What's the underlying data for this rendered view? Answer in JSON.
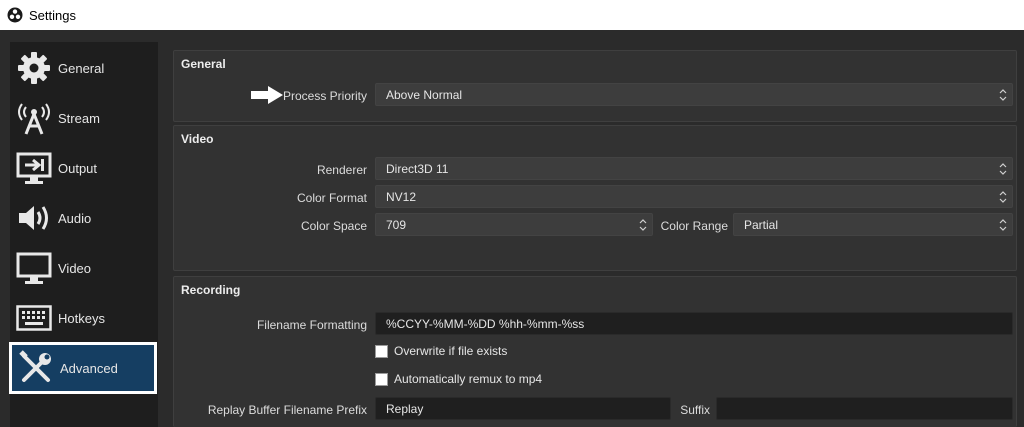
{
  "window": {
    "title": "Settings"
  },
  "sidebar": {
    "items": [
      {
        "label": "General",
        "icon": "gear-icon"
      },
      {
        "label": "Stream",
        "icon": "broadcast-antenna-icon"
      },
      {
        "label": "Output",
        "icon": "output-monitor-icon"
      },
      {
        "label": "Audio",
        "icon": "speaker-icon"
      },
      {
        "label": "Video",
        "icon": "monitor-icon"
      },
      {
        "label": "Hotkeys",
        "icon": "keyboard-icon"
      },
      {
        "label": "Advanced",
        "icon": "tools-icon",
        "selected": true
      }
    ]
  },
  "general": {
    "title": "General",
    "process_priority_label": "Process Priority",
    "process_priority_value": "Above Normal"
  },
  "video": {
    "title": "Video",
    "renderer_label": "Renderer",
    "renderer_value": "Direct3D 11",
    "color_format_label": "Color Format",
    "color_format_value": "NV12",
    "color_space_label": "Color Space",
    "color_space_value": "709",
    "color_range_label": "Color Range",
    "color_range_value": "Partial"
  },
  "recording": {
    "title": "Recording",
    "filename_formatting_label": "Filename Formatting",
    "filename_formatting_value": "%CCYY-%MM-%DD %hh-%mm-%ss",
    "overwrite_label": "Overwrite if file exists",
    "overwrite_checked": false,
    "remux_label": "Automatically remux to mp4",
    "remux_checked": false,
    "replay_prefix_label": "Replay Buffer Filename Prefix",
    "replay_prefix_value": "Replay",
    "suffix_label": "Suffix",
    "suffix_value": ""
  },
  "colors": {
    "background": "#2b2b2b",
    "sidebar": "#1e1e1e",
    "selected": "#153e62",
    "group": "#323232"
  }
}
